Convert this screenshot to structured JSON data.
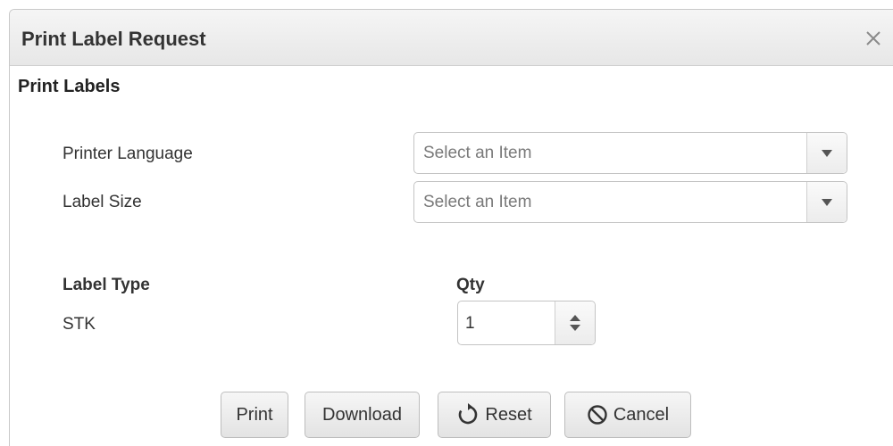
{
  "dialog": {
    "title": "Print Label Request",
    "close_icon": "close-icon"
  },
  "section": {
    "title": "Print Labels"
  },
  "fields": {
    "printer_language": {
      "label": "Printer Language",
      "value": "Select an Item"
    },
    "label_size": {
      "label": "Label Size",
      "value": "Select an Item"
    }
  },
  "labels_table": {
    "type_header": "Label Type",
    "qty_header": "Qty",
    "rows": [
      {
        "type": "STK",
        "qty": "1"
      }
    ]
  },
  "buttons": {
    "print": "Print",
    "download": "Download",
    "reset": "Reset",
    "cancel": "Cancel"
  },
  "icons": {
    "dropdown": "chevron-down-icon",
    "stepper": "spinner-arrows-icon",
    "reset": "refresh-icon",
    "cancel": "ban-icon"
  }
}
